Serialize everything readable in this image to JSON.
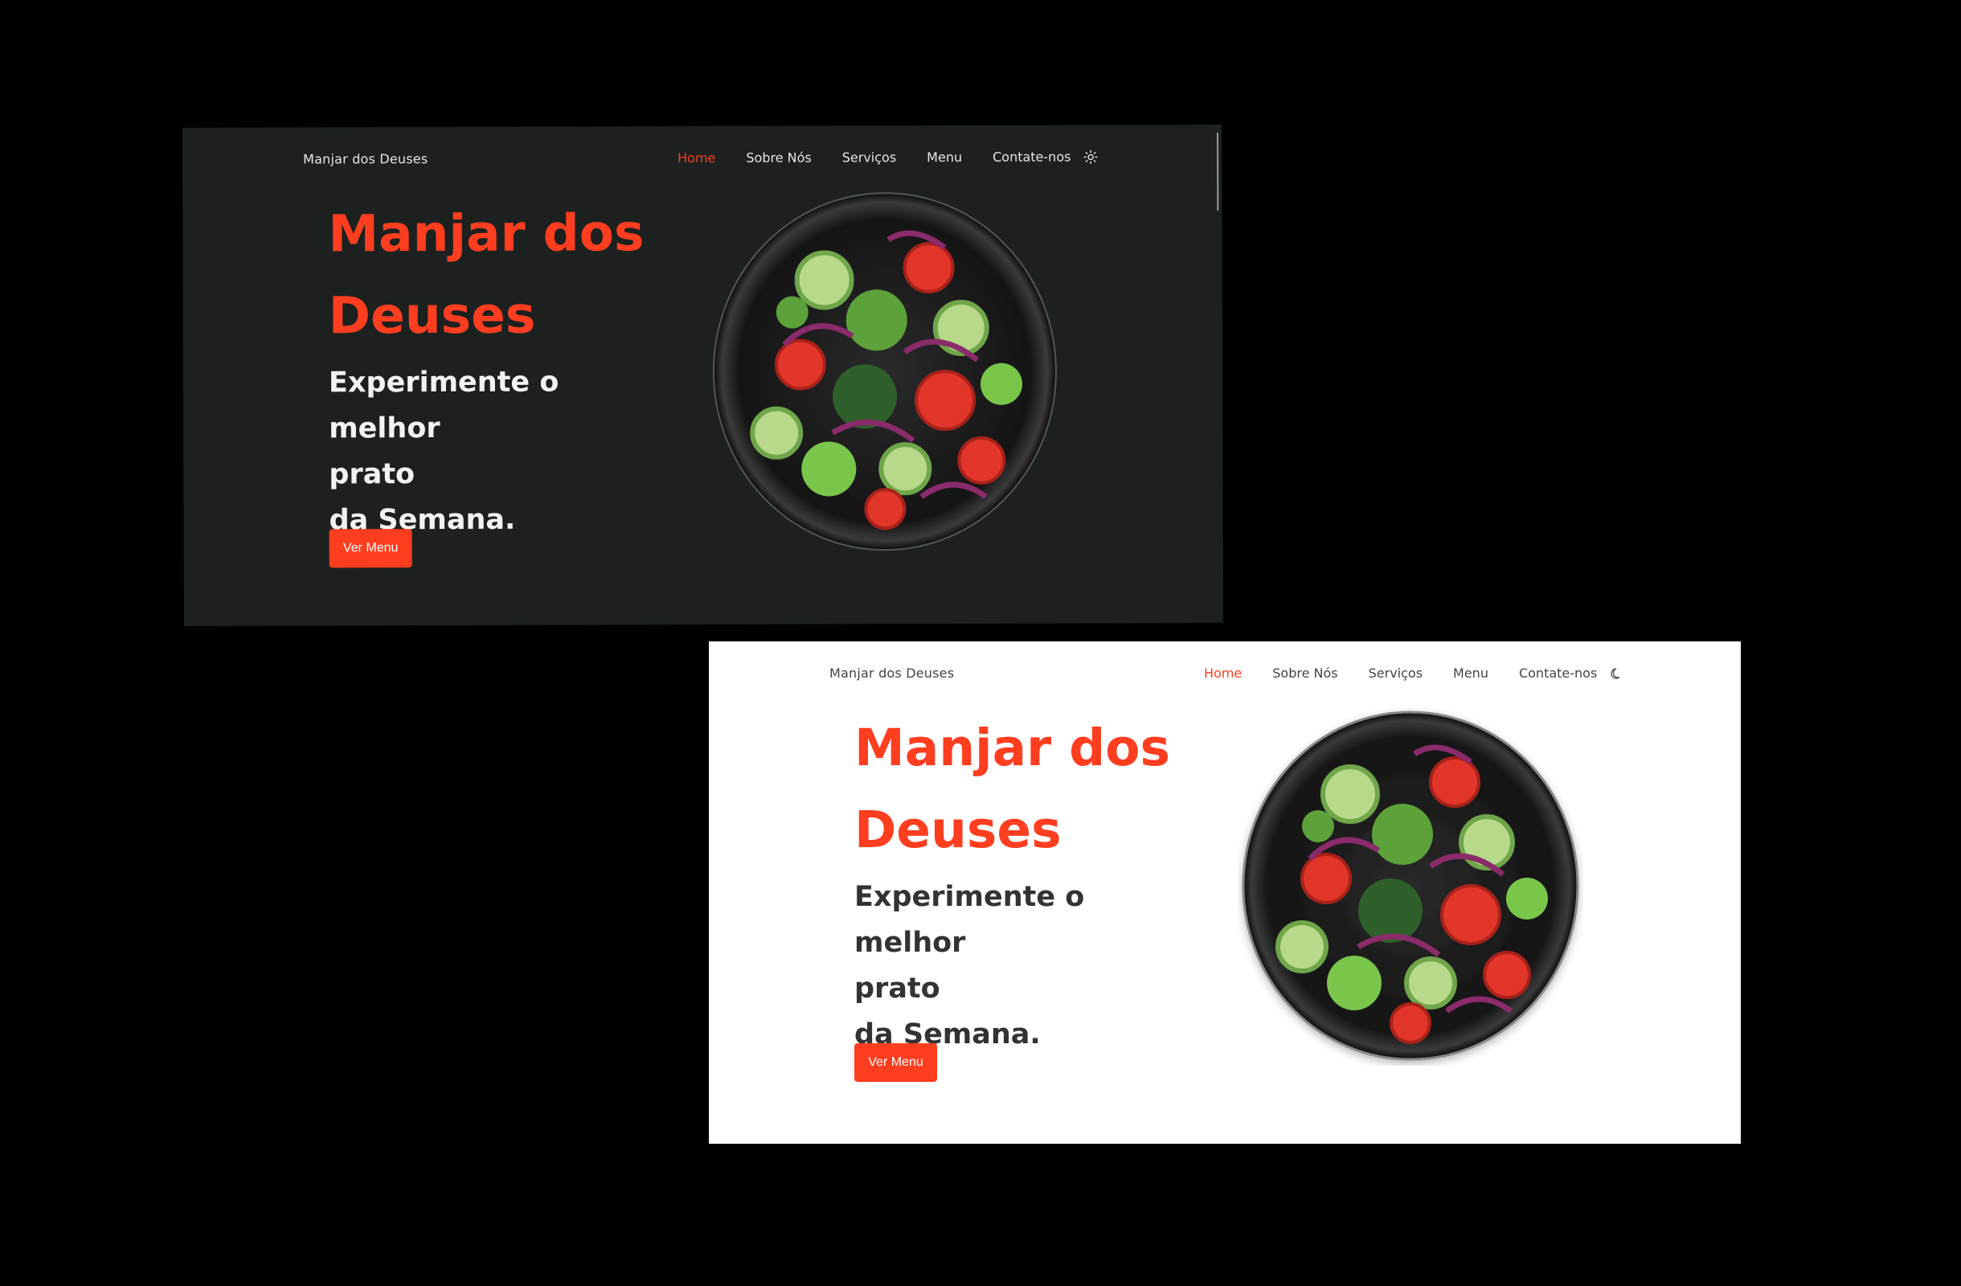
{
  "brand": "Manjar dos Deuses",
  "nav": {
    "items": [
      {
        "label": "Home",
        "active": true
      },
      {
        "label": "Sobre Nós",
        "active": false
      },
      {
        "label": "Serviços",
        "active": false
      },
      {
        "label": "Menu",
        "active": false
      },
      {
        "label": "Contate-nos",
        "active": false
      }
    ]
  },
  "hero": {
    "title_line1": "Manjar dos",
    "title_line2": "Deuses",
    "sub_line1": "Experimente o melhor",
    "sub_line2": "prato",
    "sub_line3": "da Semana.",
    "button": "Ver Menu"
  },
  "themes": {
    "dark": {
      "background": "#1c211f",
      "toggle_icon": "sun-icon"
    },
    "light": {
      "background": "#ffffff",
      "toggle_icon": "moon-icon"
    }
  },
  "colors": {
    "accent": "#ff3d1f"
  }
}
